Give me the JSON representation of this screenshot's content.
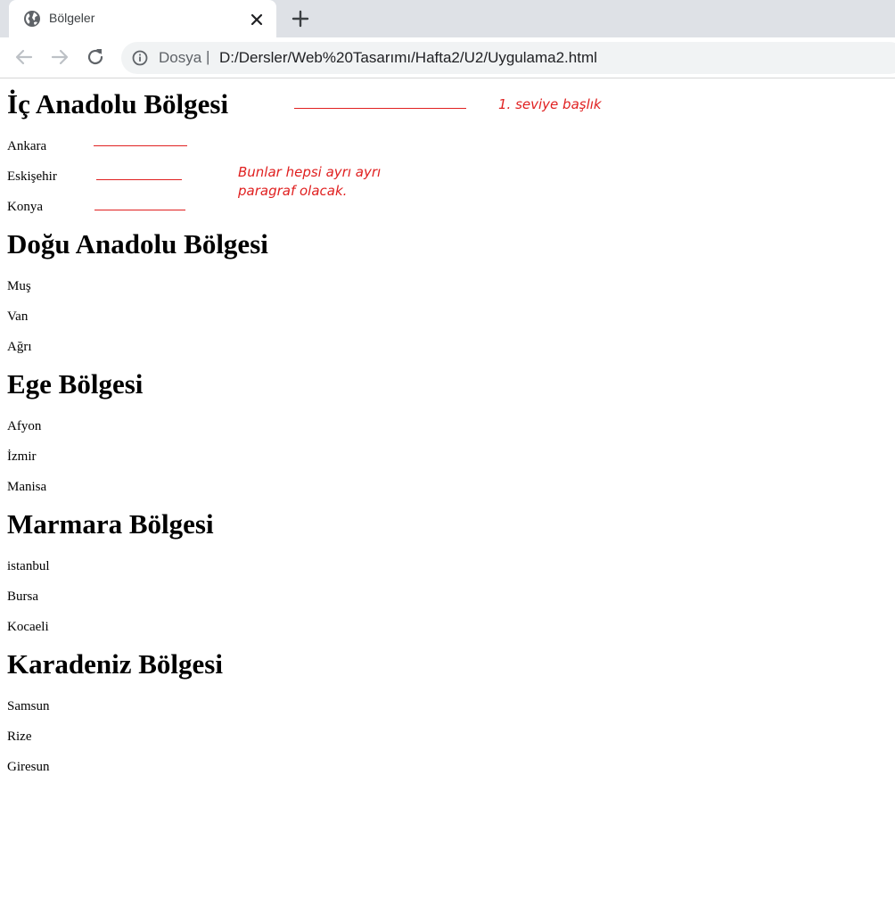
{
  "browser": {
    "tab": {
      "title": "Bölgeler",
      "favicon": "globe-icon",
      "close_icon": "close-icon"
    },
    "new_tab_icon": "plus-icon",
    "nav": {
      "back_icon": "back-arrow-icon",
      "forward_icon": "forward-arrow-icon",
      "reload_icon": "reload-icon"
    },
    "address_bar": {
      "info_icon": "info-icon",
      "scheme_label": "Dosya",
      "separator": "|",
      "url": "D:/Dersler/Web%20Tasarımı/Hafta2/U2/Uygulama2.html"
    }
  },
  "page": {
    "sections": [
      {
        "heading": "İç Anadolu Bölgesi",
        "cities": [
          "Ankara",
          "Eskişehir",
          "Konya"
        ]
      },
      {
        "heading": "Doğu Anadolu Bölgesi",
        "cities": [
          "Muş",
          "Van",
          "Ağrı"
        ]
      },
      {
        "heading": "Ege Bölgesi",
        "cities": [
          "Afyon",
          "İzmir",
          "Manisa"
        ]
      },
      {
        "heading": "Marmara Bölgesi",
        "cities": [
          "istanbul",
          "Bursa",
          "Kocaeli"
        ]
      },
      {
        "heading": "Karadeniz Bölgesi",
        "cities": [
          "Samsun",
          "Rize",
          "Giresun"
        ]
      }
    ]
  },
  "annotations": {
    "heading_note": "1. seviye başlık",
    "paragraph_note_line1": "Bunlar hepsi ayrı ayrı",
    "paragraph_note_line2": "paragraf olacak.",
    "color": "#e02020"
  }
}
